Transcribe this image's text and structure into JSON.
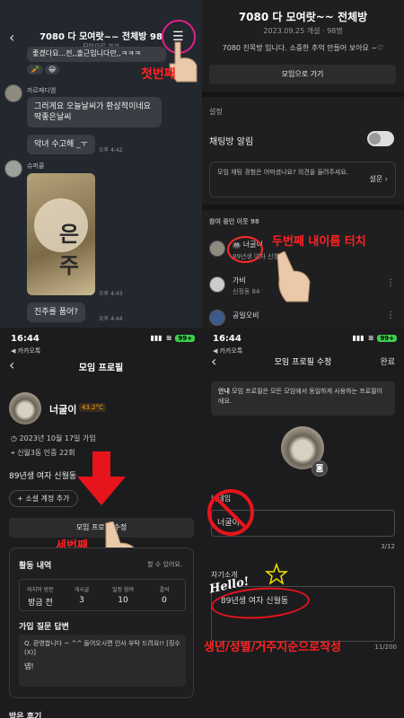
{
  "p1": {
    "title": "7080 다 모여랏~~ 전체방 98",
    "subtitle": "모임으로 가기",
    "msg_top": "좋겠다요...전,,출근입니다만,,ㅋㅋㅋ",
    "sender1": "까르페디엠",
    "msg1": "그러게요 오늘날씨가 환상적이네요 딱좋은날씨",
    "msg2": "악녀 수고해 _ㅜ",
    "time2": "오후 4:42",
    "sender2": "슈퍼쿨",
    "time3": "오후 4:43",
    "msg3": "진주를 품어?",
    "time4": "오후 4:44",
    "annotation": "첫번째"
  },
  "p2": {
    "title": "7080 다 모여랏~~ 전체방",
    "meta": "2023.09.25 개설 · 98명",
    "desc": "7080 친목방 입니다. 소중한 추억 만들어 보아요 ~♡",
    "goto_button": "모임으로 가기",
    "settings_header": "설정",
    "notification_label": "채팅방 알림",
    "survey_text": "모임 채팅 경험은 어떠셨나요? 의견을 들려주세요.",
    "survey_button": "설문",
    "members_header": "참여 중인 이웃 98",
    "member1_name": "너굴이",
    "member1_sub": "89년생 여자 신월동",
    "member2_name": "가비",
    "member2_sub": "신정동 84",
    "member3_name": "공일오비",
    "annotation": "두번째 내이름 터치"
  },
  "p3": {
    "time": "16:44",
    "carrier": "◀ 카카오톡",
    "battery": "99+",
    "title": "모임 프로필",
    "name": "너굴이",
    "temperature": "43.2°C",
    "joined": "2023년 10월 17일 가입",
    "location": "신월3동 인증 22회",
    "bio": "89년생 여자 신월동",
    "social_button": "+ 소셜 계정 추가",
    "edit_button": "모임 프로필 수정",
    "annotation": "세번째",
    "activity_title": "활동 내역",
    "activity_hint": "할 수 있어요.",
    "stats": [
      {
        "label": "마지막 방문",
        "value": "방금 전"
      },
      {
        "label": "게시글",
        "value": "3"
      },
      {
        "label": "일정 참여",
        "value": "10"
      },
      {
        "label": "결석",
        "value": "0"
      }
    ],
    "answer_title": "가입 질문 답변",
    "question": "Q. 환영합니다 ~ ^^ 들어오시면 인사 부탁 드려요!! [징수(X)]",
    "answer": "넵!",
    "bottom_text": "받은 후기"
  },
  "p4": {
    "time": "16:44",
    "carrier": "◀ 카카오톡",
    "battery": "99+",
    "title": "모임 프로필 수정",
    "done": "완료",
    "notice_bold": "안내",
    "notice": "모임 프로필은 모든 모임에서 동일하게 사용하는 프로필이에요.",
    "nickname_label": "닉네임",
    "nickname_value": "너굴이",
    "nickname_count": "3/12",
    "intro_label": "자기소개",
    "intro_value": "89년생 여자 신월동",
    "intro_count": "11/200",
    "hello": "Hello!",
    "annotation": "생년/성별/거주지순으로작성"
  }
}
